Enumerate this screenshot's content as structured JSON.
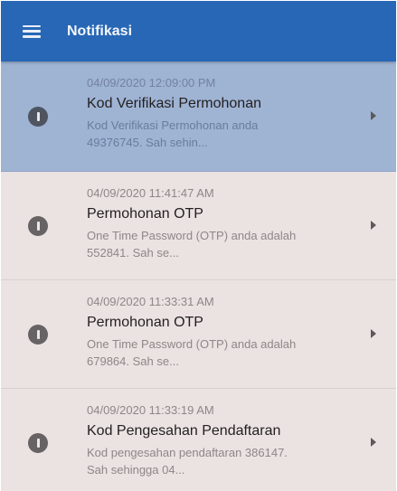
{
  "appbar": {
    "title": "Notifikasi"
  },
  "notifications": [
    {
      "timestamp": "04/09/2020 12:09:00 PM",
      "title": "Kod Verifikasi Permohonan",
      "body_line1": "Kod Verifikasi Permohonan anda",
      "body_line2": "49376745. Sah sehin..."
    },
    {
      "timestamp": "04/09/2020 11:41:47 AM",
      "title": "Permohonan OTP",
      "body_line1": "One Time Password (OTP) anda adalah",
      "body_line2": "552841. Sah se..."
    },
    {
      "timestamp": "04/09/2020 11:33:31 AM",
      "title": "Permohonan OTP",
      "body_line1": "One Time Password (OTP) anda adalah",
      "body_line2": "679864. Sah se..."
    },
    {
      "timestamp": "04/09/2020 11:33:19 AM",
      "title": "Kod Pengesahan Pendaftaran",
      "body_line1": "Kod pengesahan pendaftaran 386147.",
      "body_line2": "Sah sehingga 04..."
    }
  ],
  "colors": {
    "appbar": "#2767b6",
    "selected_row": "#9fb3d3",
    "row_background": "#ebe3e2"
  }
}
